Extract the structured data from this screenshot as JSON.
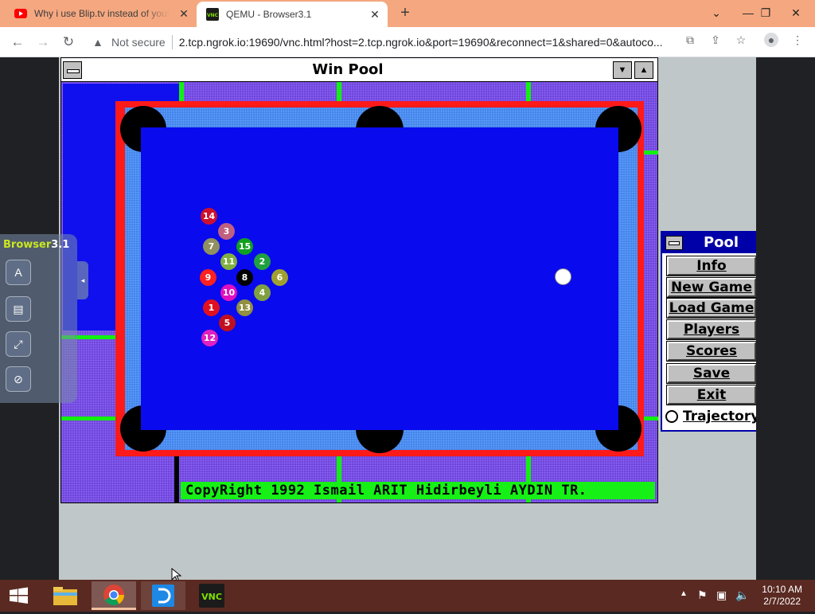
{
  "browser": {
    "tabs": [
      {
        "title": "Why i use Blip.tv instead of youtube",
        "favicon": "youtube-icon",
        "active": false
      },
      {
        "title": "QEMU - Browser3.1",
        "favicon": "vnc-icon",
        "active": true
      }
    ],
    "new_tab": "+",
    "window_controls": {
      "chevron": "⌄",
      "minimize": "—",
      "restore": "❐",
      "close": "✕"
    },
    "toolbar": {
      "not_secure": "Not secure",
      "url": "2.tcp.ngrok.io:19690/vnc.html?host=2.tcp.ngrok.io&port=19690&reconnect=1&shared=0&autoco..."
    }
  },
  "novnc": {
    "logo_part1": "Browser",
    "logo_part2": "3.1",
    "buttons": [
      {
        "icon": "keyboard-icon",
        "glyph": "A"
      },
      {
        "icon": "clipboard-icon",
        "glyph": "▤"
      },
      {
        "icon": "fullscreen-icon",
        "glyph": "⤢"
      },
      {
        "icon": "disconnect-icon",
        "glyph": "⊘"
      }
    ],
    "handle": "◂"
  },
  "winpool": {
    "title": "Win Pool",
    "copyright": "CopyRight 1992 Ismail ARIT Hidirbeyli AYDIN TR."
  },
  "balls": [
    {
      "n": "14",
      "color": "#cc1030"
    },
    {
      "n": "3",
      "color": "#c06080"
    },
    {
      "n": "7",
      "color": "#909060"
    },
    {
      "n": "15",
      "color": "#10a020"
    },
    {
      "n": "11",
      "color": "#80b040"
    },
    {
      "n": "2",
      "color": "#20a040"
    },
    {
      "n": "9",
      "color": "#ff2020"
    },
    {
      "n": "8",
      "color": "#000000"
    },
    {
      "n": "6",
      "color": "#a0a030"
    },
    {
      "n": "10",
      "color": "#e010c0"
    },
    {
      "n": "4",
      "color": "#80a040"
    },
    {
      "n": "1",
      "color": "#e01020"
    },
    {
      "n": "13",
      "color": "#909040"
    },
    {
      "n": "5",
      "color": "#c01020"
    },
    {
      "n": "12",
      "color": "#e020c0"
    },
    {
      "n": "",
      "color": "#ffffff"
    }
  ],
  "pool_panel": {
    "title": "Pool",
    "buttons": [
      "Info",
      "New Game",
      "Load Game",
      "Players",
      "Scores",
      "Save",
      "Exit"
    ],
    "trajectory": "Trajectory"
  },
  "taskbar": {
    "apps": [
      "file-explorer-icon",
      "chrome-icon",
      "remote-desktop-icon",
      "vnc-icon"
    ],
    "time": "10:10 AM",
    "date": "2/7/2022"
  }
}
